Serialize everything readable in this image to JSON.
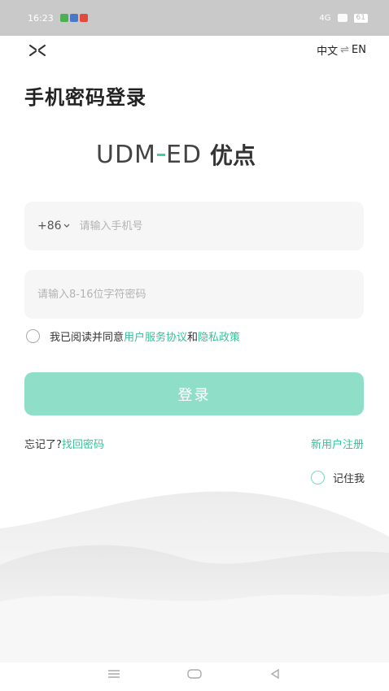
{
  "status_bar": {
    "time": "16:23",
    "notification_colors": [
      "#4caf50",
      "#4a78c8",
      "#e24b3b"
    ],
    "signal_text": "4G",
    "battery": "61"
  },
  "header": {
    "close_icon": "close-x-icon",
    "lang_cn": "中文",
    "lang_sep": "⇌",
    "lang_en": "EN"
  },
  "title": "手机密码登录",
  "logo": {
    "en_part1": "UDM",
    "en_part2": "ED",
    "cn": "优点",
    "accent_color": "#3ecf9f"
  },
  "phone": {
    "country_code": "+86",
    "placeholder": "请输入手机号"
  },
  "password": {
    "placeholder": "请输入8-16位字符密码"
  },
  "agreement": {
    "prefix": "我已阅读并同意",
    "terms_link": "用户服务协议",
    "and": "和",
    "privacy_link": "隐私政策"
  },
  "login_button": "登录",
  "forgot": {
    "prefix": "忘记了?",
    "link": "找回密码"
  },
  "register_link": "新用户注册",
  "remember": "记住我",
  "colors": {
    "brand_green": "#33c39a",
    "button_bg": "#8fdfc8",
    "input_bg": "#f6f6f6"
  }
}
